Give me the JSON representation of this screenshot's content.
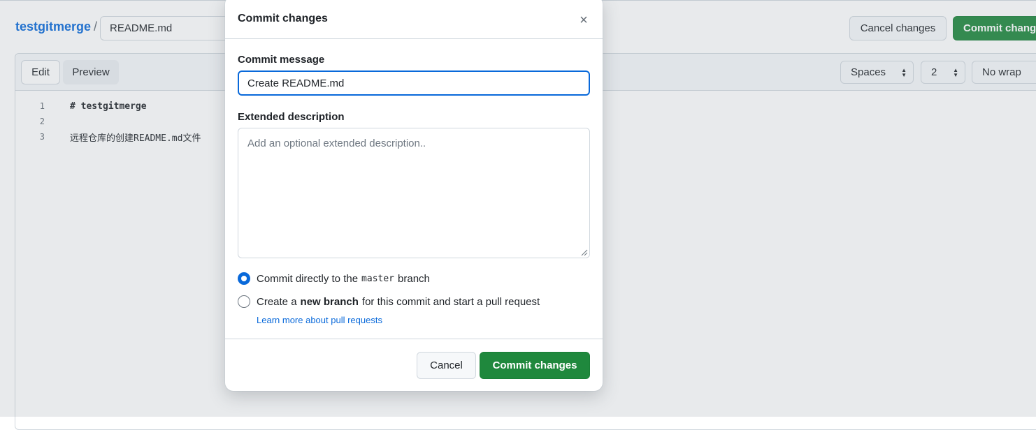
{
  "header": {
    "repo_name": "testgitmerge",
    "separator": "/",
    "filename_value": "README.md",
    "cancel_label": "Cancel changes",
    "commit_label": "Commit changes"
  },
  "editor": {
    "tabs": [
      {
        "label": "Edit",
        "active": true
      },
      {
        "label": "Preview",
        "active": false
      }
    ],
    "indent_mode": "Spaces",
    "indent_size": "2",
    "wrap_mode": "No wrap",
    "lines": [
      {
        "num": "1",
        "text": "# testgitmerge"
      },
      {
        "num": "2",
        "text": ""
      },
      {
        "num": "3",
        "text": "远程仓库的创建README.md文件"
      }
    ]
  },
  "dialog": {
    "title": "Commit changes",
    "close_icon": "×",
    "commit_message_label": "Commit message",
    "commit_message_value": "Create README.md",
    "extended_label": "Extended description",
    "extended_placeholder": "Add an optional extended description..",
    "option_direct": {
      "prefix": "Commit directly to the",
      "branch": "master",
      "suffix": "branch",
      "selected": true
    },
    "option_new": {
      "prefix": "Create a",
      "bold": "new branch",
      "suffix": "for this commit and start a pull request",
      "selected": false
    },
    "learn_more": "Learn more about pull requests",
    "cancel_label": "Cancel",
    "commit_label": "Commit changes"
  },
  "colors": {
    "primary_green": "#1f883d",
    "link_blue": "#0969da",
    "focus_blue": "#0969da",
    "border": "#d0d7de"
  }
}
